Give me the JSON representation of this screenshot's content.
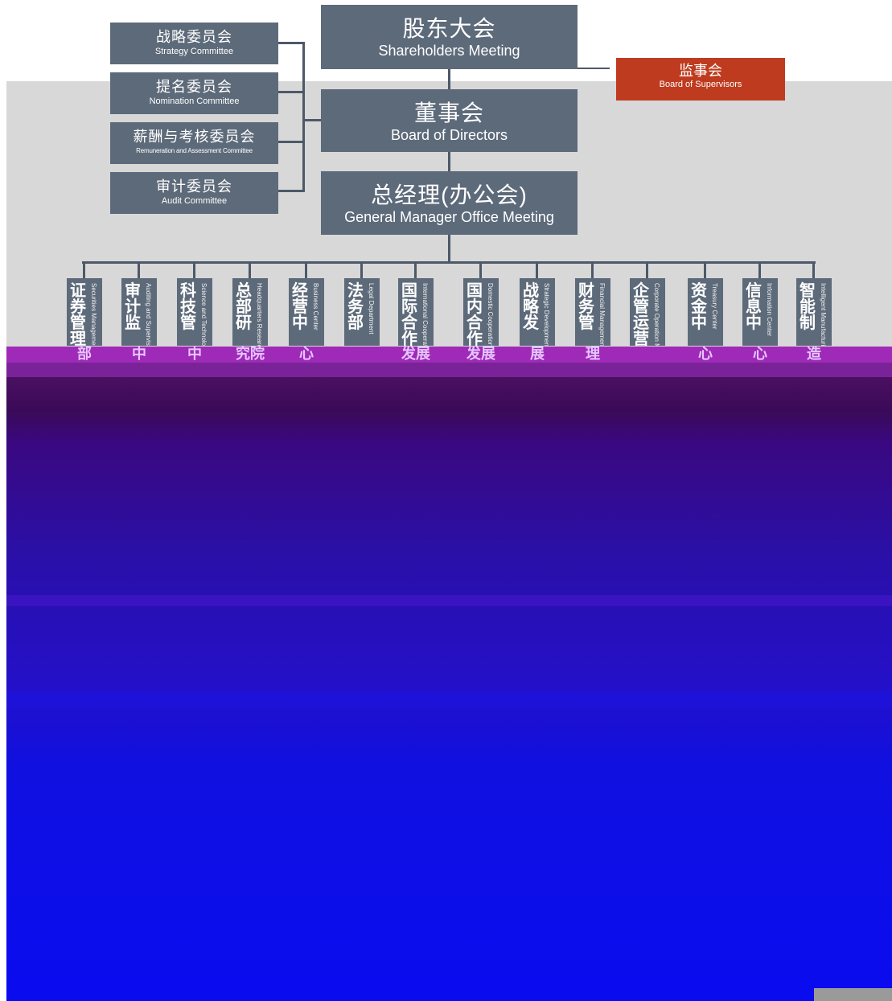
{
  "shareholders": {
    "zh": "股东大会",
    "en": "Shareholders Meeting"
  },
  "board": {
    "zh": "董事会",
    "en": "Board of Directors"
  },
  "gm": {
    "zh": "总经理(办公会)",
    "en": "General Manager Office Meeting"
  },
  "supervisors": {
    "zh": "监事会",
    "en": "Board of Supervisors"
  },
  "committees": [
    {
      "zh": "战略委员会",
      "en": "Strategy Committee"
    },
    {
      "zh": "提名委员会",
      "en": "Nomination Committee"
    },
    {
      "zh": "薪酬与考核委员会",
      "en": "Remuneration and Assessment Committee"
    },
    {
      "zh": "审计委员会",
      "en": "Audit Committee"
    }
  ],
  "departments": [
    {
      "zh": "证券管理",
      "tail": "部",
      "en": "Securities Management Department"
    },
    {
      "zh": "审计监",
      "tail": "中",
      "en": "Auditing and Supervision Center"
    },
    {
      "zh": "科技管",
      "tail": "中",
      "en": "Science and Technology Management Center"
    },
    {
      "zh": "总部研",
      "tail": "究院",
      "en": "Headquarters Research Institute"
    },
    {
      "zh": "经营中",
      "tail": "心",
      "en": "Business Center"
    },
    {
      "zh": "法务部",
      "tail": "",
      "en": "Legal Department"
    },
    {
      "zh": "国际合作",
      "tail": "发展",
      "en": "International Cooperation and Development"
    },
    {
      "zh": "国内合作",
      "tail": "发展",
      "en": "Domestic Cooperation and Development"
    },
    {
      "zh": "战略发",
      "tail": "展",
      "en": "Strategic Development"
    },
    {
      "zh": "财务管",
      "tail": "理",
      "en": "Financial Management"
    },
    {
      "zh": "企管运营",
      "tail": "",
      "en": "Corporate Operation Management"
    },
    {
      "zh": "资金中",
      "tail": "心",
      "en": "Treasury Center"
    },
    {
      "zh": "信息中",
      "tail": "心",
      "en": "Information Center"
    },
    {
      "zh": "智能制",
      "tail": "造",
      "en": "Intelligent Manufacturing"
    }
  ],
  "colors": {
    "box": "#5d6a7a",
    "supervisors": "#bf3b1f",
    "panel": "#d8d8d8",
    "line": "#4d5968"
  }
}
